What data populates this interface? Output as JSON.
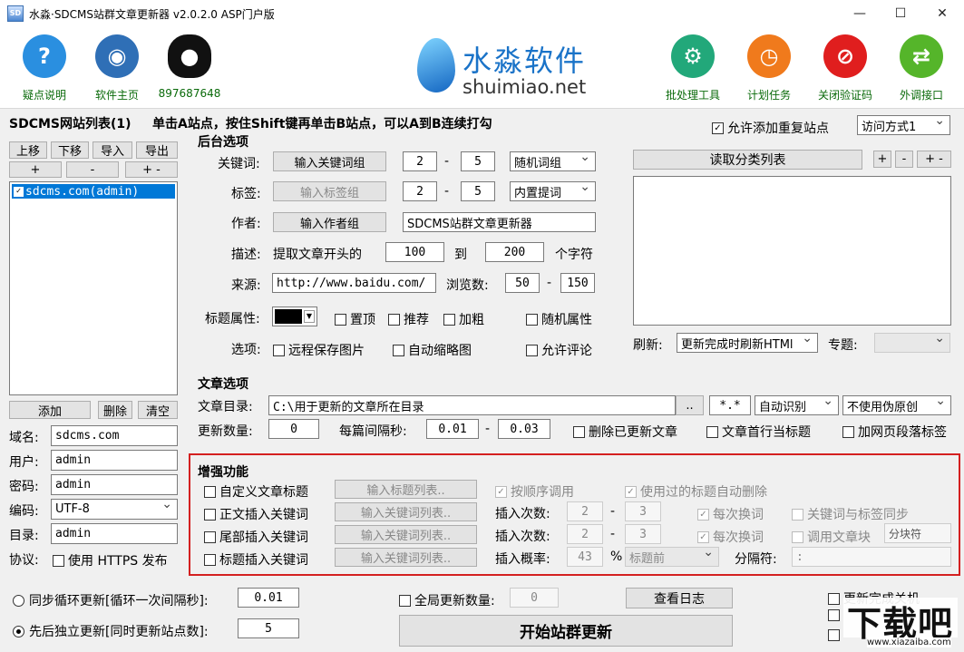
{
  "window": {
    "title": "水淼·SDCMS站群文章更新器 v2.0.2.0 ASP门户版",
    "icon": "SD",
    "minimize": "—",
    "maximize": "☐",
    "close": "✕"
  },
  "toolbar": {
    "left": [
      {
        "label": "疑点说明",
        "icon": "help-icon",
        "glyph": "?",
        "color": "#2a8fe0"
      },
      {
        "label": "软件主页",
        "icon": "globe-icon",
        "glyph": "◉",
        "color": "#2f6fb6"
      },
      {
        "label": "897687648",
        "icon": "qq-penguin-icon",
        "glyph": "●",
        "color": "#111111"
      }
    ],
    "right": [
      {
        "label": "批处理工具",
        "icon": "gear-icon",
        "glyph": "⚙",
        "color": "#22a87a"
      },
      {
        "label": "计划任务",
        "icon": "clock-icon",
        "glyph": "◷",
        "color": "#f07a1c"
      },
      {
        "label": "关闭验证码",
        "icon": "no-entry-icon",
        "glyph": "⊘",
        "color": "#e01e1e"
      },
      {
        "label": "外调接口",
        "icon": "swap-arrows-icon",
        "glyph": "⇄",
        "color": "#55b52a"
      }
    ]
  },
  "logo": {
    "cn": "水淼软件",
    "en": "shuimiao.net"
  },
  "site_list": {
    "title": "SDCMS网站列表(1)",
    "hint": "单击A站点，按住Shift键再单击B站点，可以A到B连续打勾",
    "allow_dup": "允许添加重复站点",
    "access_mode": "访问方式1",
    "btns": {
      "up": "上移",
      "down": "下移",
      "import": "导入",
      "export": "导出",
      "plus": "+",
      "minus": "-",
      "pm": "+ -"
    },
    "items": [
      "sdcms.com(admin)"
    ],
    "add": "添加",
    "delete": "删除",
    "clear": "清空",
    "fields": {
      "domain_label": "域名:",
      "domain": "sdcms.com",
      "user_label": "用户:",
      "user": "admin",
      "pwd_label": "密码:",
      "pwd": "admin",
      "enc_label": "编码:",
      "enc": "UTF-8",
      "dir_label": "目录:",
      "dir": "admin",
      "proto_label": "协议:",
      "https": "使用 HTTPS 发布"
    }
  },
  "backend": {
    "title": "后台选项",
    "kw_label": "关键词:",
    "kw_btn": "输入关键词组",
    "kw_min": "2",
    "kw_max": "5",
    "kw_mode": "随机词组",
    "dash": "-",
    "tag_label": "标签:",
    "tag_btn": "输入标签组",
    "tag_min": "2",
    "tag_max": "5",
    "tag_mode": "内置提词",
    "author_label": "作者:",
    "author_btn": "输入作者组",
    "author": "SDCMS站群文章更新器",
    "desc_label": "描述:",
    "desc_pre": "提取文章开头的",
    "desc_from": "100",
    "desc_to_label": "到",
    "desc_to": "200",
    "desc_unit": "个字符",
    "src_label": "来源:",
    "src": "http://www.baidu.com/",
    "views_label": "浏览数:",
    "views_min": "50",
    "views_max": "150",
    "title_attr": "标题属性:",
    "top": "置顶",
    "recommend": "推荐",
    "bold": "加粗",
    "rand_attr": "随机属性",
    "opt_label": "选项:",
    "remote_img": "远程保存图片",
    "auto_thumb": "自动缩略图",
    "allow_comment": "允许评论",
    "read_cat": "读取分类列表",
    "refresh_label": "刷新:",
    "refresh": "更新完成时刷新HTMl",
    "topic_label": "专题:",
    "topic": ""
  },
  "article": {
    "title": "文章选项",
    "dir_label": "文章目录:",
    "dir": "C:\\用于更新的文章所在目录",
    "browse": "..",
    "ext": "*.*",
    "detect": "自动识别",
    "pseudo": "不使用伪原创",
    "count_label": "更新数量:",
    "count": "0",
    "interval_label": "每篇间隔秒:",
    "int_min": "0.01",
    "int_max": "0.03",
    "del_updated": "删除已更新文章",
    "first_line": "文章首行当标题",
    "para_tag": "加网页段落标签"
  },
  "enhance": {
    "title": "增强功能",
    "custom_title": "自定义文章标题",
    "title_list": "输入标题列表..",
    "seq": "按顺序调用",
    "used_del": "使用过的标题自动删除",
    "body_kw": "正文插入关键词",
    "kw_list": "输入关键词列表..",
    "ins_count": "插入次数:",
    "c1min": "2",
    "c1max": "3",
    "each": "每次换词",
    "kw_tag_sync": "关键词与标签同步",
    "tail_kw": "尾部插入关键词",
    "c2min": "2",
    "c2max": "3",
    "call_block": "调用文章块",
    "block_sep": "分块符",
    "title_kw": "标题插入关键词",
    "ins_prob": "插入概率:",
    "prob": "43",
    "pct": "%",
    "pos": "标题前",
    "sep_label": "分隔符:",
    "sep": ":"
  },
  "bottom": {
    "sync_loop": "同步循环更新[循环一次间隔秒]:",
    "sync_val": "0.01",
    "seq_update": "先后独立更新[同时更新站点数]:",
    "seq_val": "5",
    "global_count": "全局更新数量:",
    "global_val": "0",
    "view_log": "查看日志",
    "start": "开始站群更新",
    "shutdown": "更新完成关机"
  },
  "watermark": {
    "cn": "下载吧",
    "url": "www.xiazaiba.com"
  }
}
